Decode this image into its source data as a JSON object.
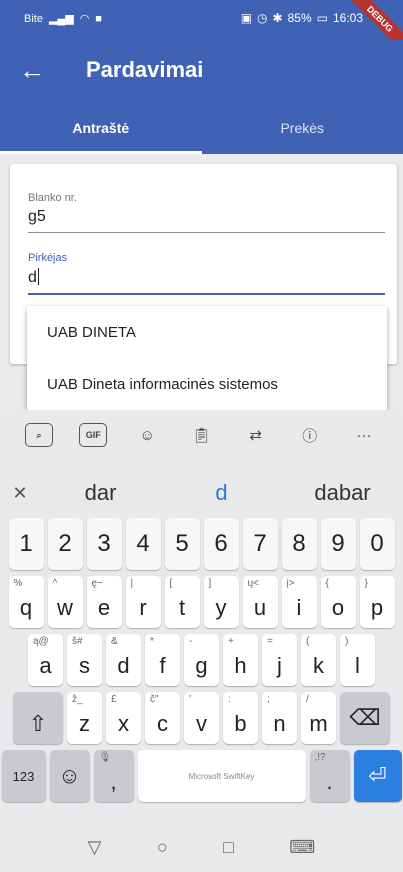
{
  "status_bar": {
    "carrier": "Bite",
    "battery": "85%",
    "time": "16:03",
    "debug": "DEBUG"
  },
  "app_bar": {
    "back_icon": "arrow-left-icon",
    "title": "Pardavimai"
  },
  "tabs": [
    {
      "label": "Antraštė",
      "active": true
    },
    {
      "label": "Prekės",
      "active": false
    }
  ],
  "form": {
    "blanko": {
      "label": "Blanko nr.",
      "value": "g5"
    },
    "pirkejas": {
      "label": "Pirkėjas",
      "value": "d"
    }
  },
  "suggestions": [
    "UAB DINETA",
    "UAB Dineta informacinės sistemos"
  ],
  "keyboard": {
    "toolbar": {
      "gif_label": "GIF",
      "more_label": "···"
    },
    "predictions": {
      "left": "dar",
      "middle": "d",
      "right": "dabar"
    },
    "row_numbers": [
      "1",
      "2",
      "3",
      "4",
      "5",
      "6",
      "7",
      "8",
      "9",
      "0"
    ],
    "row_q": [
      {
        "k": "q",
        "h": "%"
      },
      {
        "k": "w",
        "h": "^"
      },
      {
        "k": "e",
        "h": "ę~"
      },
      {
        "k": "r",
        "h": "|"
      },
      {
        "k": "t",
        "h": "["
      },
      {
        "k": "y",
        "h": "]"
      },
      {
        "k": "u",
        "h": "ų<"
      },
      {
        "k": "i",
        "h": "į>"
      },
      {
        "k": "o",
        "h": "{"
      },
      {
        "k": "p",
        "h": "}"
      }
    ],
    "row_a": [
      {
        "k": "a",
        "h": "ą@"
      },
      {
        "k": "s",
        "h": "š#"
      },
      {
        "k": "d",
        "h": "&"
      },
      {
        "k": "f",
        "h": "*"
      },
      {
        "k": "g",
        "h": "-"
      },
      {
        "k": "h",
        "h": "+"
      },
      {
        "k": "j",
        "h": "="
      },
      {
        "k": "k",
        "h": "("
      },
      {
        "k": "l",
        "h": ")"
      }
    ],
    "row_z": [
      {
        "k": "z",
        "h": "ž_"
      },
      {
        "k": "x",
        "h": "£"
      },
      {
        "k": "c",
        "h": "č\""
      },
      {
        "k": "v",
        "h": "'"
      },
      {
        "k": "b",
        "h": ":"
      },
      {
        "k": "n",
        "h": ";"
      },
      {
        "k": "m",
        "h": "/"
      }
    ],
    "bottom": {
      "num_label": "123",
      "comma": ",",
      "space_label": "Microsoft SwiftKey",
      "period": ".",
      "period_hint": ",!?"
    }
  }
}
